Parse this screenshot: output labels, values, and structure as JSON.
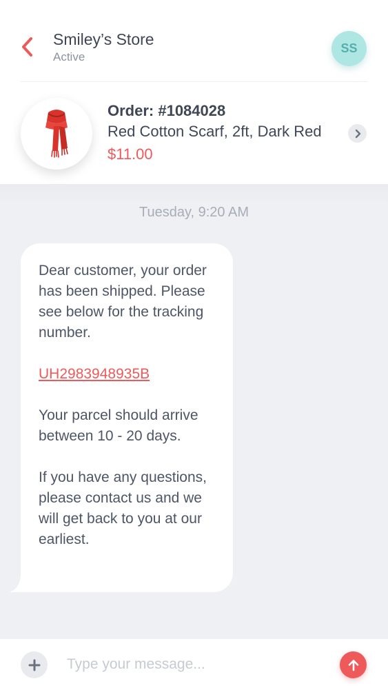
{
  "header": {
    "store_name": "Smiley’s Store",
    "status": "Active",
    "avatar_initials": "SS",
    "back_icon": "chevron-left-icon",
    "accent_color": "#ee5a5a",
    "avatar_color": "#aee6e3"
  },
  "order": {
    "number": "Order: #1084028",
    "description": "Red Cotton Scarf, 2ft, Dark Red",
    "price": "$11.00",
    "thumbnail_icon": "scarf-icon",
    "chevron_icon": "chevron-right-icon"
  },
  "chat": {
    "timestamp": "Tuesday, 9:20 AM",
    "message": {
      "paragraph_1": "Dear customer, your order has been shipped. Please see below for the tracking number.",
      "tracking_number": "UH2983948935B",
      "paragraph_2": "Your parcel should arrive between 10 - 20 days.",
      "paragraph_3": "If you have any questions, please contact us and we will get back to you at our earliest."
    }
  },
  "composer": {
    "placeholder": "Type your message...",
    "value": "",
    "add_icon": "plus-icon",
    "send_icon": "arrow-up-icon"
  }
}
